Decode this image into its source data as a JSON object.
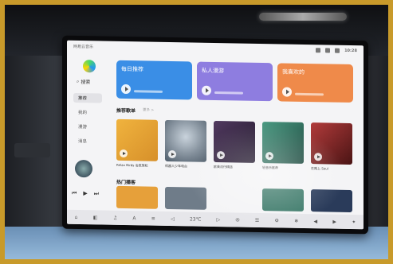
{
  "scene": "car-ceiling-entertainment-screen",
  "screen": {
    "status": {
      "left": "网易云音乐",
      "time": "10:28"
    },
    "sidebar": {
      "search_label": "搜索",
      "items": [
        {
          "label": "推荐",
          "active": true
        },
        {
          "label": "我的",
          "active": false
        },
        {
          "label": "漫游",
          "active": false
        },
        {
          "label": "消息",
          "active": false
        }
      ]
    },
    "banners": [
      {
        "label": "每日推荐",
        "color": "#3a8ee6"
      },
      {
        "label": "私人漫游",
        "color": "#8e7de0"
      },
      {
        "label": "我喜欢的",
        "color": "#ef8a4a"
      }
    ],
    "sections": {
      "recommended_title": "推荐歌单",
      "recommended_more": "更多 >",
      "second_title": "热门播客"
    },
    "cards": [
      {
        "title": "Relax Birds 治愈放松",
        "color": "#e7a33a"
      },
      {
        "title": "机器人少年电台",
        "color": "#6b7b8c"
      },
      {
        "title": "欧美流行精选",
        "color": "#3b2e45"
      },
      {
        "title": "轻音乐推荐",
        "color": "#2f6b5b"
      },
      {
        "title": "在路上 Soul",
        "color": "#8a2b2b"
      }
    ],
    "mini_player": {
      "controls": [
        "⏮",
        "▶",
        "⏭"
      ]
    },
    "bottom_bar": [
      "⌂",
      "◧",
      "♫",
      "A",
      "≡",
      "◁",
      "23℃",
      "▷",
      "✇",
      "☰",
      "⚙",
      "❄",
      "◀",
      "▶",
      "✦"
    ]
  }
}
